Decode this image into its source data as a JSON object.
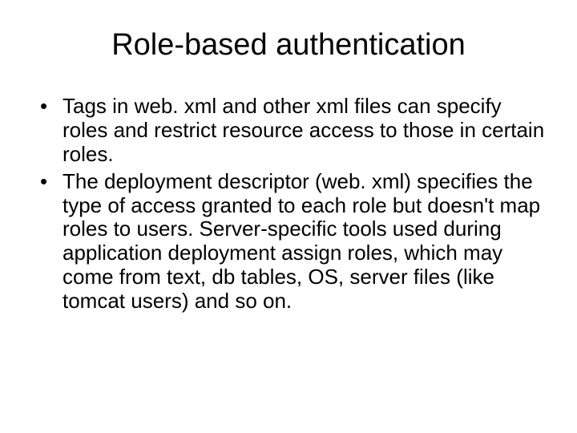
{
  "slide": {
    "title": "Role-based authentication",
    "bullets": [
      "Tags in web. xml and other xml files can specify roles and restrict resource access to those in certain roles.",
      "The deployment descriptor (web. xml) specifies the type of access granted to each role but doesn't map roles to users. Server-specific tools used during application deployment assign roles, which may come from text, db tables, OS, server files (like tomcat users) and so on."
    ]
  }
}
